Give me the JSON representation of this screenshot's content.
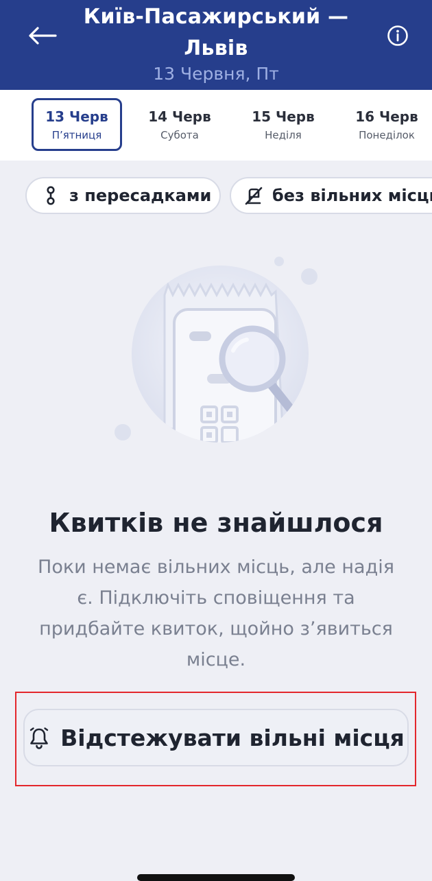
{
  "header": {
    "title": "Київ-Пасажирський — Львів",
    "subtitle": "13 Червня, Пт"
  },
  "dates": [
    {
      "day": "13 Черв",
      "weekday": "П’ятниця",
      "active": true
    },
    {
      "day": "14 Черв",
      "weekday": "Субота",
      "active": false
    },
    {
      "day": "15 Черв",
      "weekday": "Неділя",
      "active": false
    },
    {
      "day": "16 Черв",
      "weekday": "Понеділок",
      "active": false
    }
  ],
  "filters": [
    {
      "label": "з пересадками",
      "icon": "transfer-icon"
    },
    {
      "label": "без вільних місць",
      "icon": "no-seat-icon"
    }
  ],
  "empty_state": {
    "title": "Квитків не знайшлося",
    "description": "Поки немає вільних місць, але надія є. Підключіть сповіщення та придбайте квиток, щойно з’явиться місце."
  },
  "track_button": {
    "label": "Відстежувати вільні місця",
    "icon": "bell-icon"
  },
  "colors": {
    "brand": "#263e8c",
    "background": "#eeeff5",
    "highlight": "#e3262c"
  }
}
